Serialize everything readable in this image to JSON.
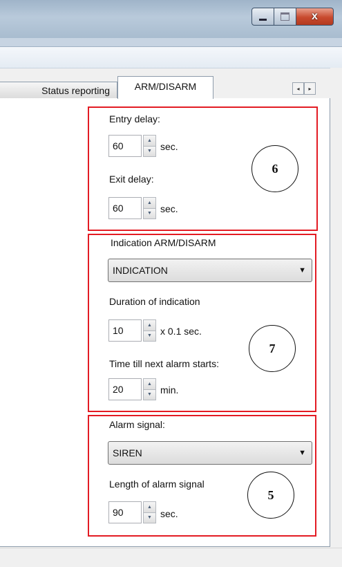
{
  "window": {
    "close_glyph": "x"
  },
  "tabs": [
    {
      "label": "Status reporting"
    },
    {
      "label": "ARM/DISARM"
    }
  ],
  "tab_scroll": {
    "left": "◂",
    "right": "▸"
  },
  "section6": {
    "entry_delay_label": "Entry delay:",
    "entry_delay_value": "60",
    "entry_delay_unit": "sec.",
    "exit_delay_label": "Exit delay:",
    "exit_delay_value": "60",
    "exit_delay_unit": "sec.",
    "marker": "6"
  },
  "section7": {
    "heading": "Indication ARM/DISARM",
    "indication_select": "INDICATION",
    "duration_label": "Duration of indication",
    "duration_value": "10",
    "duration_unit": "x 0.1 sec.",
    "next_alarm_label": "Time till next alarm starts:",
    "next_alarm_value": "20",
    "next_alarm_unit": "min.",
    "marker": "7"
  },
  "section5": {
    "alarm_signal_label": "Alarm signal:",
    "alarm_signal_select": "SIREN",
    "length_label": "Length of alarm signal",
    "length_value": "90",
    "length_unit": "sec.",
    "marker": "5"
  },
  "spin_arrows": {
    "up": "▲",
    "down": "▼"
  },
  "caret": "▼",
  "colors": {
    "highlight_box": "#e31b23"
  }
}
